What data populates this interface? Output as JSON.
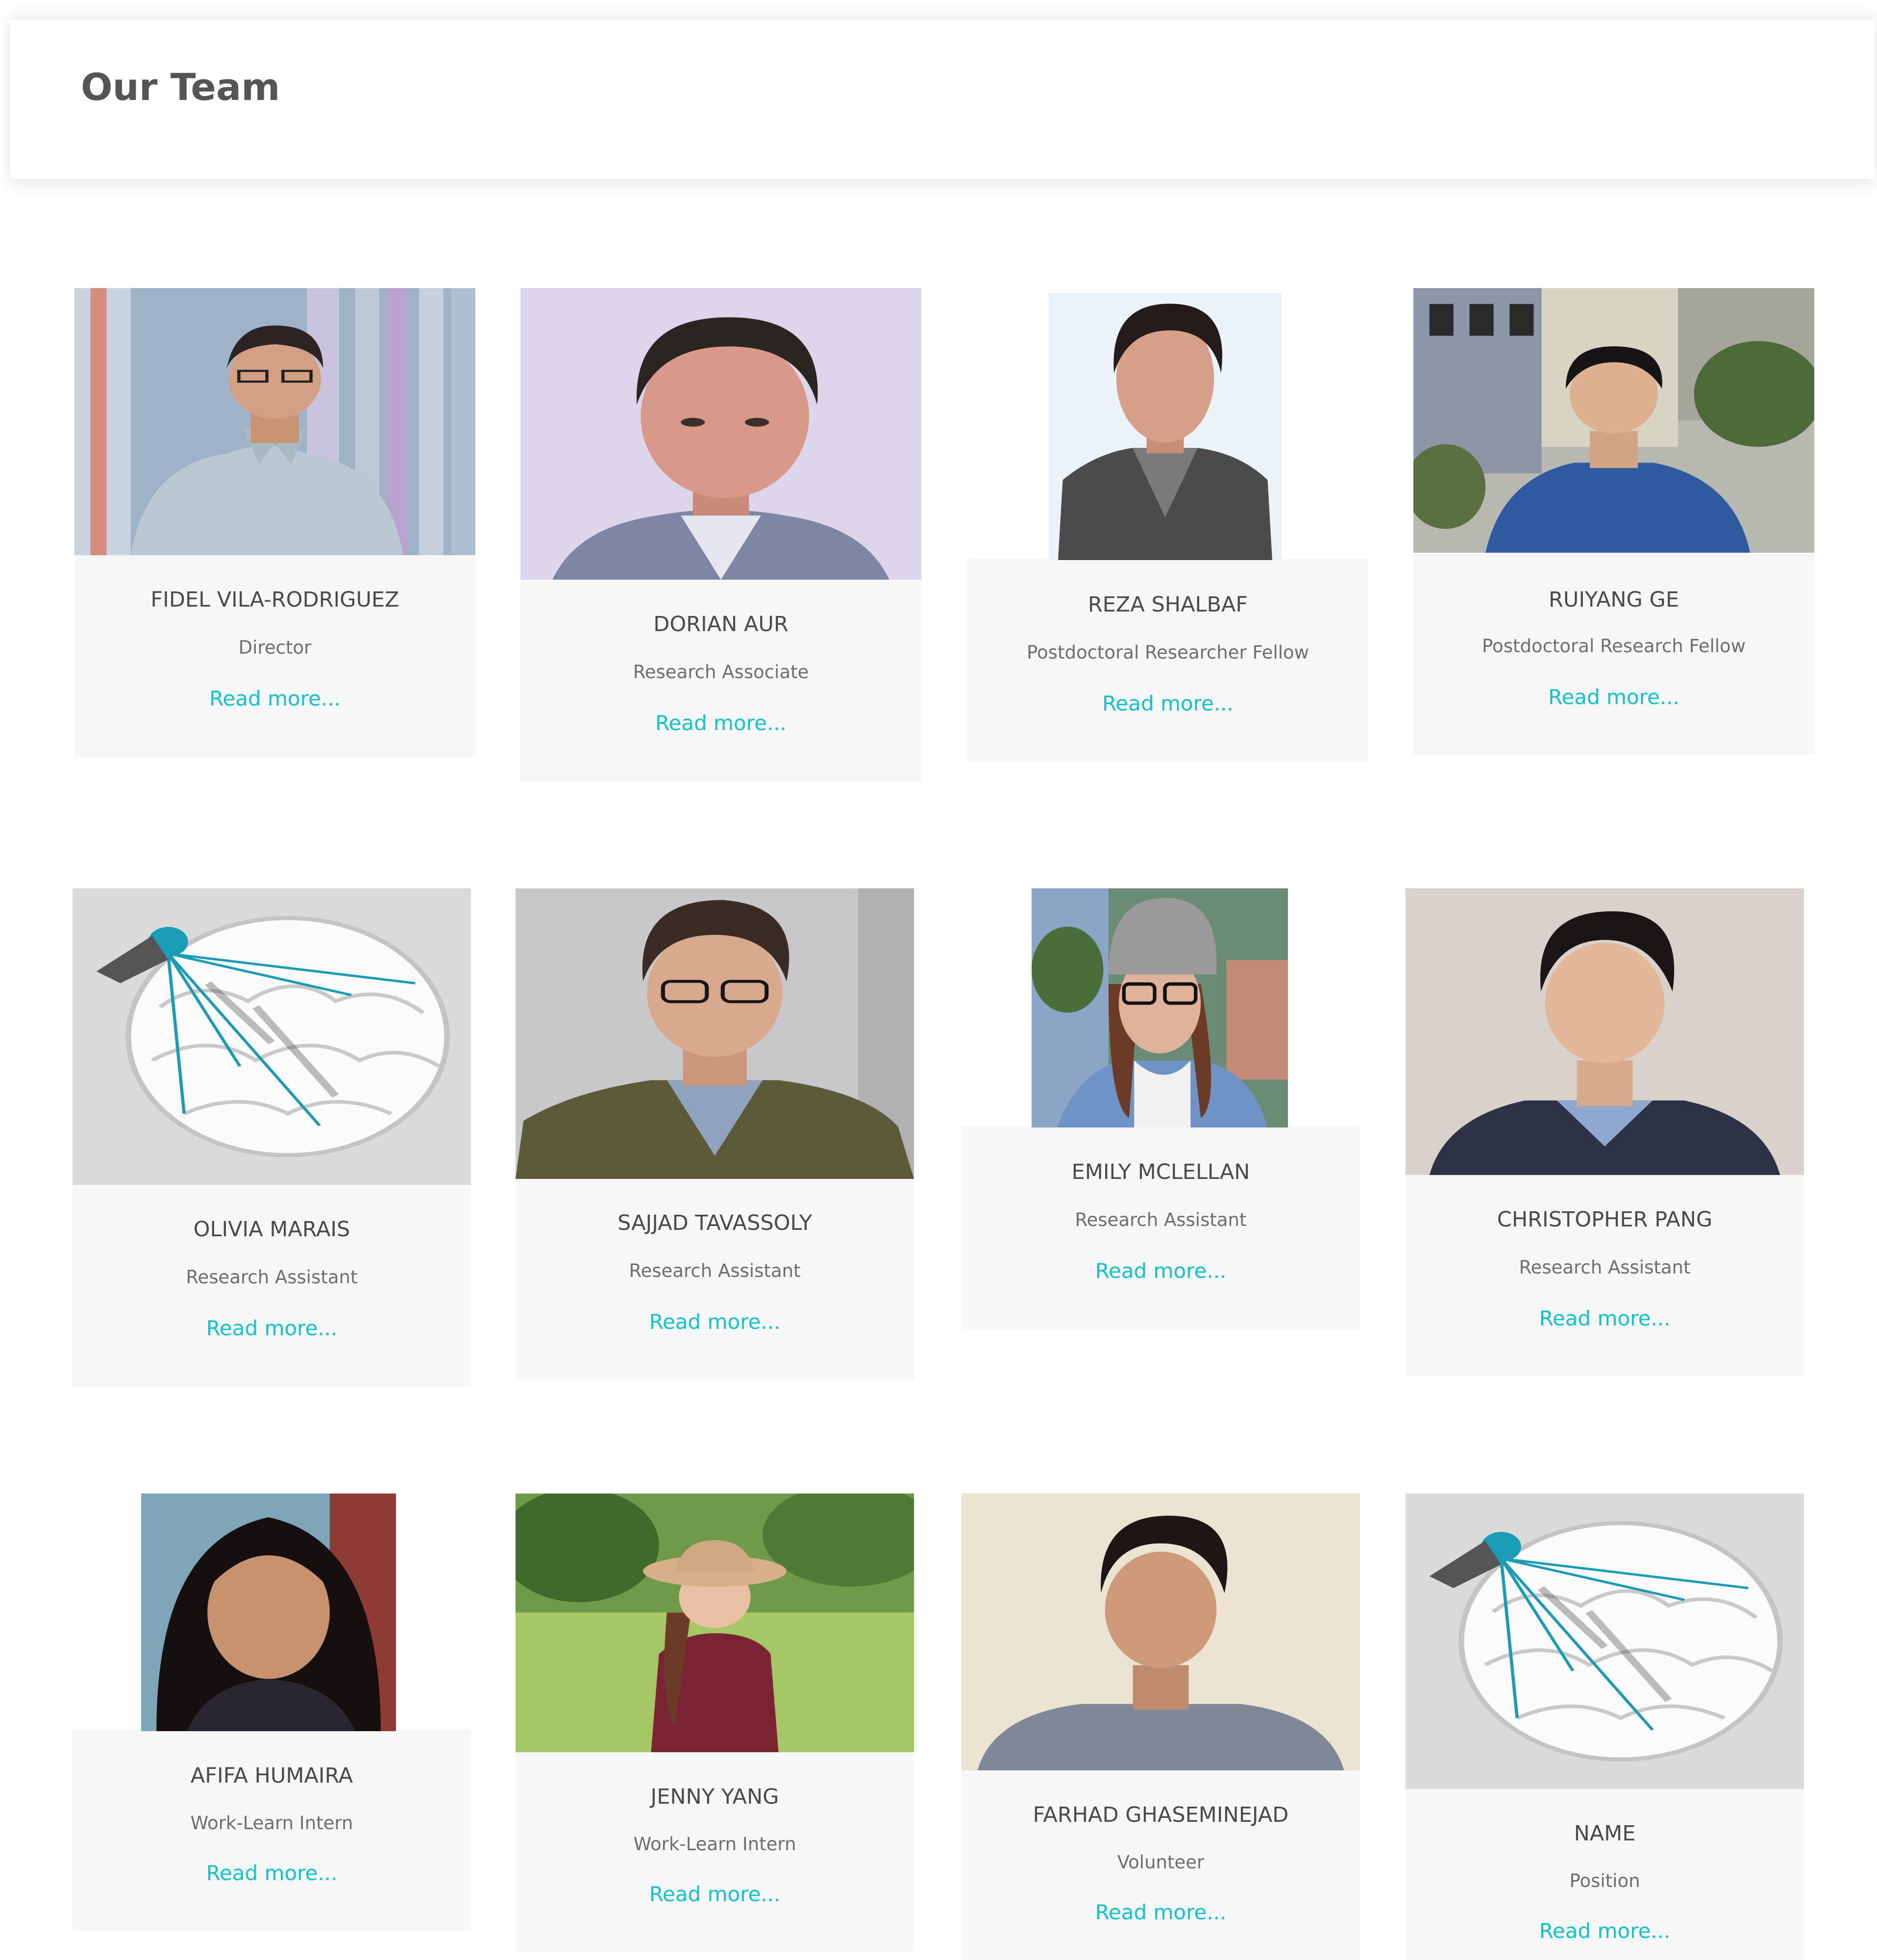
{
  "header": {
    "title": "Our Team"
  },
  "team": [
    {
      "name": "FIDEL VILA-RODRIGUEZ",
      "role": "Director",
      "link": "Read more..."
    },
    {
      "name": "DORIAN AUR",
      "role": "Research Associate",
      "link": "Read more..."
    },
    {
      "name": "REZA SHALBAF",
      "role": "Postdoctoral Researcher Fellow",
      "link": "Read more..."
    },
    {
      "name": "RUIYANG GE",
      "role": "Postdoctoral Research Fellow",
      "link": "Read more..."
    },
    {
      "name": "OLIVIA MARAIS",
      "role": "Research Assistant",
      "link": "Read more..."
    },
    {
      "name": "SAJJAD TAVASSOLY",
      "role": "Research Assistant",
      "link": "Read more..."
    },
    {
      "name": "EMILY MCLELLAN",
      "role": "Research Assistant",
      "link": "Read more..."
    },
    {
      "name": "CHRISTOPHER PANG",
      "role": "Research Assistant",
      "link": "Read more..."
    },
    {
      "name": "AFIFA HUMAIRA",
      "role": "Work-Learn Intern",
      "link": "Read more..."
    },
    {
      "name": "JENNY YANG",
      "role": "Work-Learn Intern",
      "link": "Read more..."
    },
    {
      "name": "FARHAD GHASEMINEJAD",
      "role": "Volunteer",
      "link": "Read more..."
    },
    {
      "name": "NAME",
      "role": "Position",
      "link": "Read more..."
    }
  ],
  "colors": {
    "link": "#10c4cc",
    "card_bg": "#f7f7f7",
    "title": "#555555",
    "name": "#4a4a4a",
    "role": "#6e6e6e"
  }
}
